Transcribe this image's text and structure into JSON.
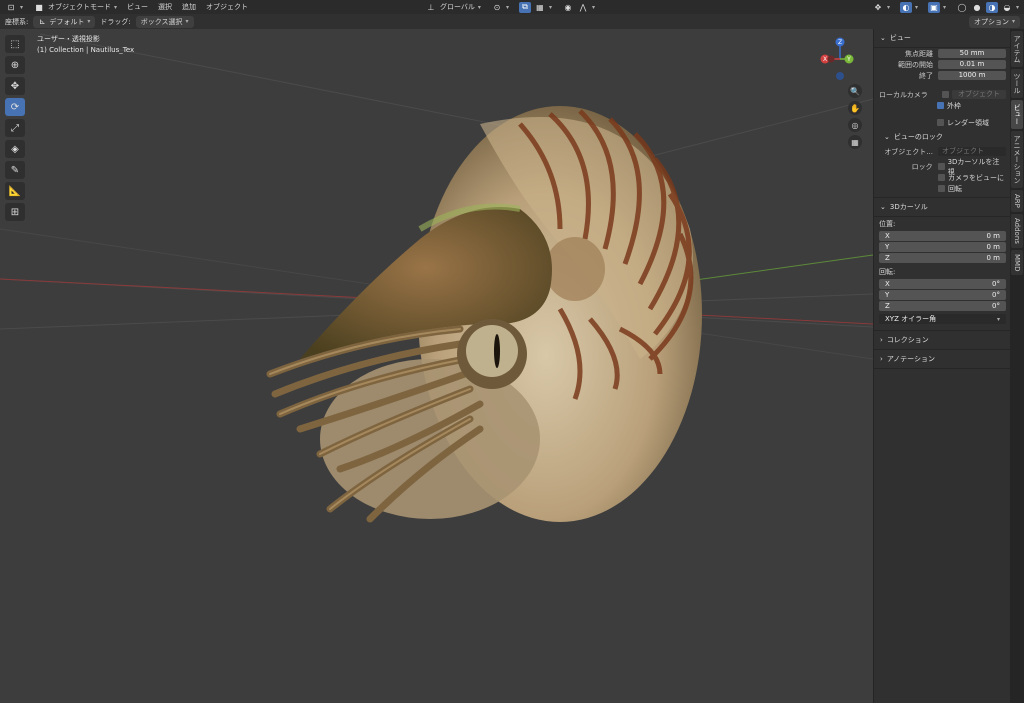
{
  "header": {
    "mode": "オブジェクトモード",
    "menus": [
      "ビュー",
      "選択",
      "追加",
      "オブジェクト"
    ],
    "orientation": "グローバル",
    "options": "オプション"
  },
  "tool_header": {
    "coord_label": "座標系:",
    "coord_value": "デフォルト",
    "drag_label": "ドラッグ:",
    "drag_value": "ボックス選択"
  },
  "viewport": {
    "view_name": "ユーザー・透視投影",
    "collection_info": "(1) Collection | Nautilus_Tex"
  },
  "gizmo": {
    "x": "X",
    "y": "Y",
    "z": "Z"
  },
  "npanel": {
    "view_section": "ビュー",
    "focal_label": "焦点距離",
    "focal_value": "50 mm",
    "clip_start_label": "範囲の開始",
    "clip_start_value": "0.01 m",
    "clip_end_label": "終了",
    "clip_end_value": "1000 m",
    "local_camera_label": "ローカルカメラ",
    "object_placeholder": "オブジェクト",
    "outer_frame": "外枠",
    "render_region": "レンダー領域",
    "view_lock_section": "ビューのロック",
    "lock_object_label": "オブジェクト...",
    "lock_label": "ロック",
    "lock_cursor": "3Dカーソルを注視",
    "lock_camera": "カメラをビューに",
    "lock_rotation": "回転",
    "cursor_section": "3Dカーソル",
    "location_label": "位置:",
    "loc": [
      {
        "axis": "X",
        "value": "0 m"
      },
      {
        "axis": "Y",
        "value": "0 m"
      },
      {
        "axis": "Z",
        "value": "0 m"
      }
    ],
    "rotation_label": "回転:",
    "rot": [
      {
        "axis": "X",
        "value": "0°"
      },
      {
        "axis": "Y",
        "value": "0°"
      },
      {
        "axis": "Z",
        "value": "0°"
      }
    ],
    "rotation_mode": "XYZ オイラー角",
    "collection_section": "コレクション",
    "annotation_section": "アノテーション"
  },
  "tabs": [
    "アイテム",
    "ツール",
    "ビュー",
    "アニメーション",
    "ARP",
    "Addons",
    "MMD"
  ]
}
